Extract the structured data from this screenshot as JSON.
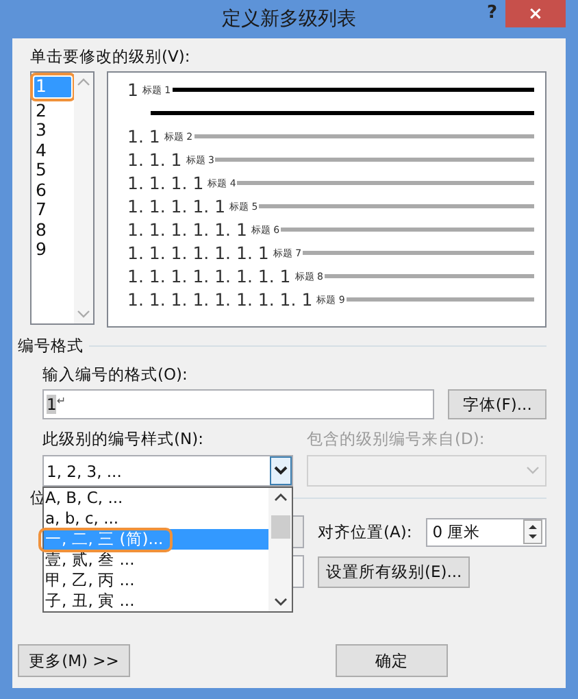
{
  "window": {
    "title": "定义新多级列表",
    "help": "?",
    "close": "×"
  },
  "level_label": "单击要修改的级别(V):",
  "levels": [
    {
      "label": "1",
      "selected": true
    },
    {
      "label": "2",
      "selected": false
    },
    {
      "label": "3",
      "selected": false
    },
    {
      "label": "4",
      "selected": false
    },
    {
      "label": "5",
      "selected": false
    },
    {
      "label": "6",
      "selected": false
    },
    {
      "label": "7",
      "selected": false
    },
    {
      "label": "8",
      "selected": false
    },
    {
      "label": "9",
      "selected": false
    }
  ],
  "preview": [
    {
      "number": "1",
      "heading": "标题 1"
    },
    {
      "number": "1. 1",
      "heading": "标题 2"
    },
    {
      "number": "1. 1. 1",
      "heading": "标题 3"
    },
    {
      "number": "1. 1. 1. 1",
      "heading": "标题 4"
    },
    {
      "number": "1. 1. 1. 1. 1",
      "heading": "标题 5"
    },
    {
      "number": "1. 1. 1. 1. 1. 1",
      "heading": "标题 6"
    },
    {
      "number": "1. 1. 1. 1. 1. 1. 1",
      "heading": "标题 7"
    },
    {
      "number": "1. 1. 1. 1. 1. 1. 1. 1",
      "heading": "标题 8"
    },
    {
      "number": "1. 1. 1. 1. 1. 1. 1. 1. 1",
      "heading": "标题 9"
    }
  ],
  "numbering": {
    "section": "编号格式",
    "format_label": "输入编号的格式(O):",
    "format_value": "1",
    "format_mark": "↵",
    "font_button": "字体(F)...",
    "style_label": "此级别的编号样式(N):",
    "style_value": "1, 2, 3, ...",
    "include_label": "包含的级别编号来自(D):",
    "include_disabled": true
  },
  "style_options": [
    {
      "label": "A, B, C, ...",
      "selected": false
    },
    {
      "label": "a, b, c, ...",
      "selected": false
    },
    {
      "label": "一, 二, 三 (简)...",
      "selected": true
    },
    {
      "label": "壹, 贰, 叁 ...",
      "selected": false
    },
    {
      "label": "甲, 乙, 丙 ...",
      "selected": false
    },
    {
      "label": "子, 丑, 寅 ...",
      "selected": false
    }
  ],
  "position": {
    "section": "位",
    "align_label": "对齐位置(A):",
    "align_value": "0 厘米",
    "set_all_button": "设置所有级别(E)..."
  },
  "buttons": {
    "more": "更多(M) >>",
    "ok": "确定"
  }
}
